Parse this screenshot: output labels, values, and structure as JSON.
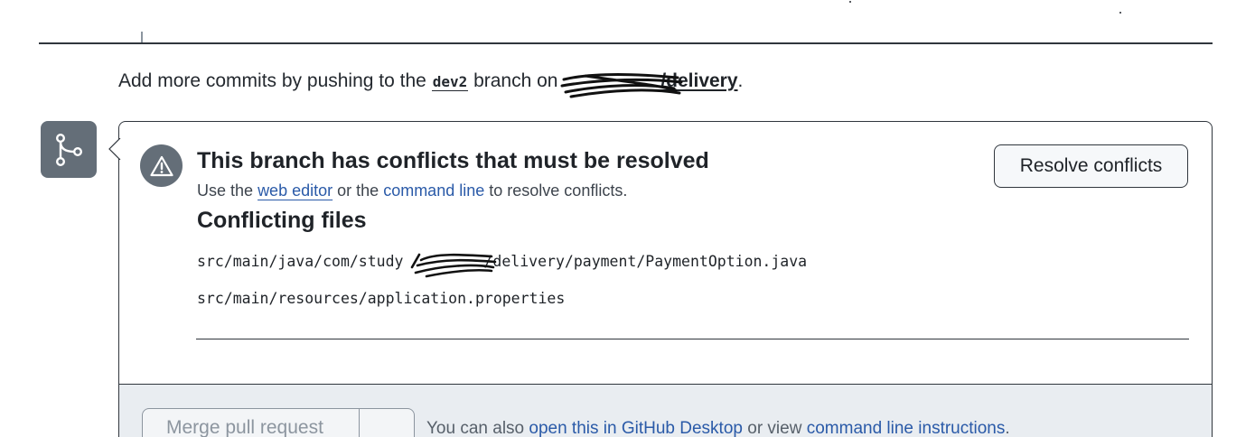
{
  "commit_hint": {
    "prefix": "Add more commits by pushing to the",
    "branch": "dev2",
    "middle": "branch on",
    "repo": "/delivery",
    "suffix": "."
  },
  "merge_status": {
    "icon": "git-merge-icon",
    "alert_icon": "alert-triangle-icon",
    "title": "This branch has conflicts that must be resolved",
    "desc_prefix": "Use the",
    "web_editor_link": "web editor",
    "desc_middle": "or the",
    "command_line_link": "command line",
    "desc_suffix": "to resolve conflicts.",
    "resolve_button": "Resolve conflicts"
  },
  "conflicting_files": {
    "heading": "Conflicting files",
    "files": [
      {
        "before": "src/main/java/com/study",
        "after": "/delivery/payment/PaymentOption.java"
      },
      {
        "before": "src/main/resources/application.properties",
        "after": ""
      }
    ]
  },
  "footer": {
    "merge_button": "Merge pull request",
    "text_prefix": "You can also",
    "desktop_link": "open this in GitHub Desktop",
    "text_middle": "or view",
    "instructions_link": "command line instructions",
    "text_suffix": "."
  },
  "colors": {
    "icon_bg": "#646e78",
    "link": "#2a5aa8",
    "footer_bg": "#e9edf1"
  }
}
